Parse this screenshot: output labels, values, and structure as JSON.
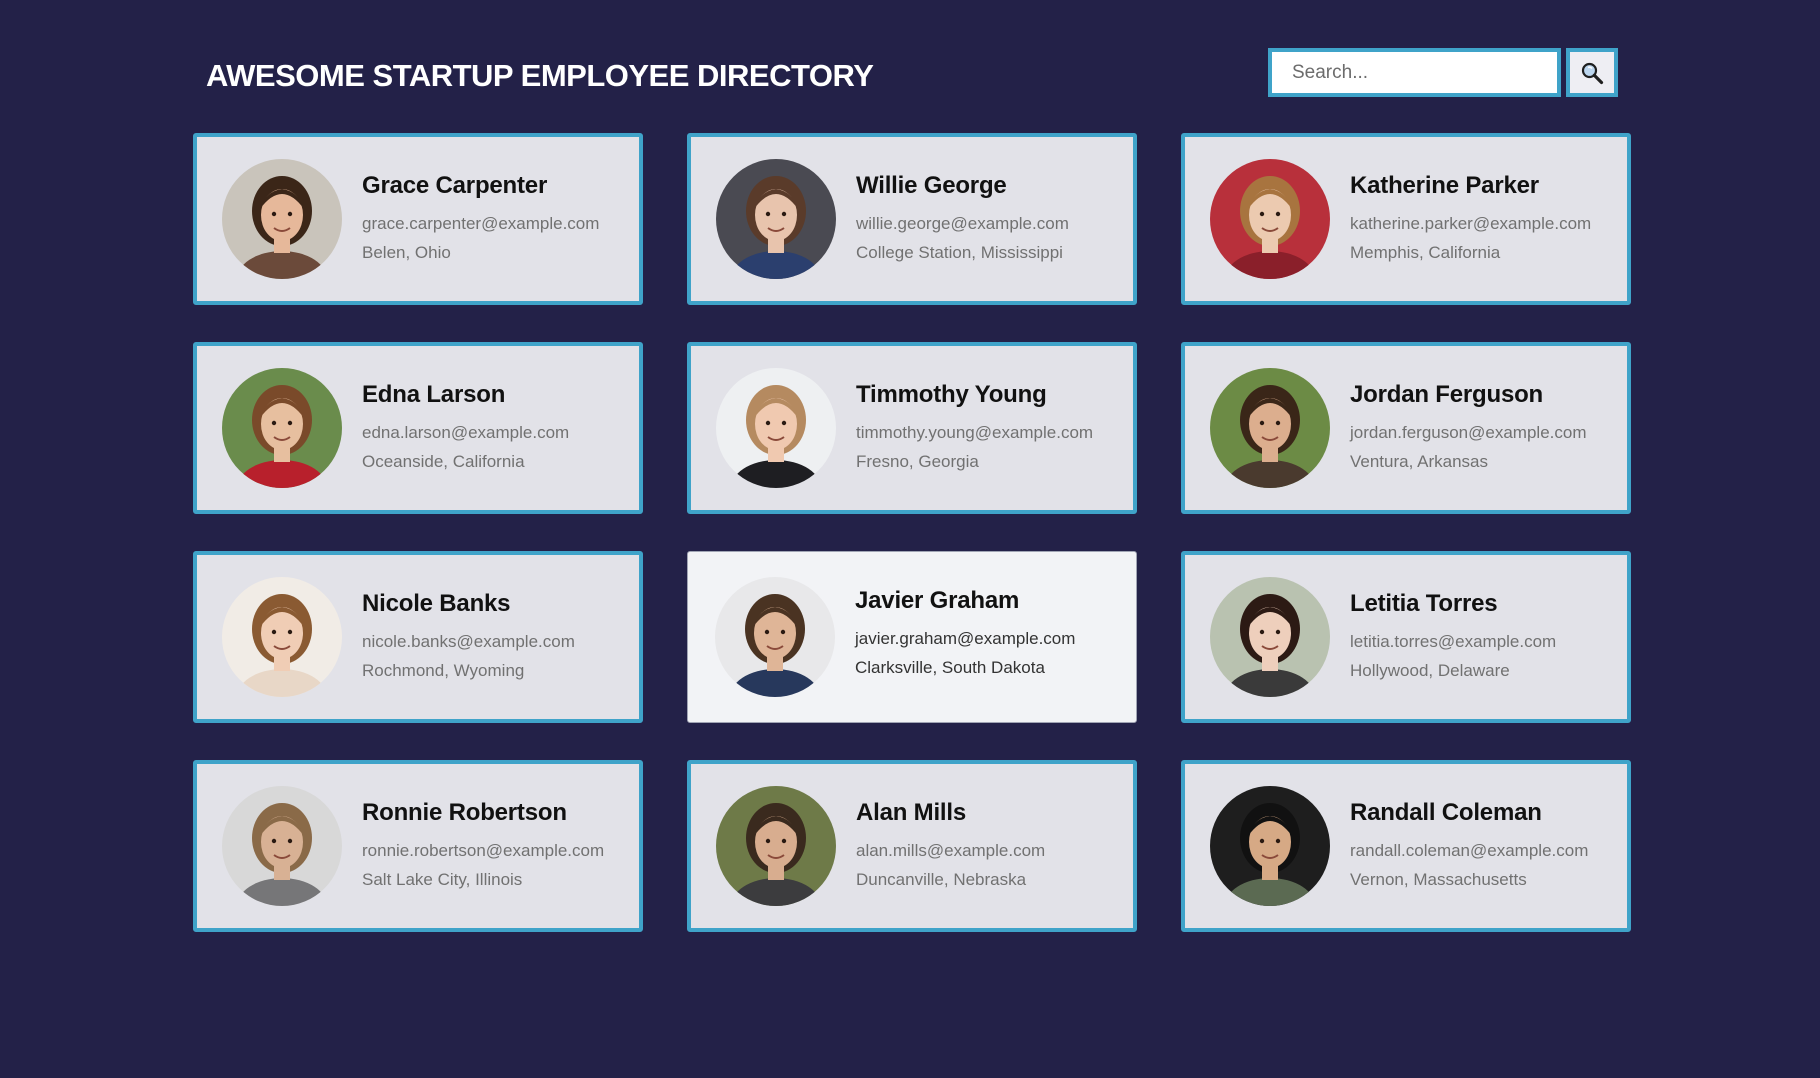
{
  "header": {
    "title": "AWESOME STARTUP EMPLOYEE DIRECTORY"
  },
  "search": {
    "placeholder": "Search...",
    "button_icon": "magnifier-icon"
  },
  "colors": {
    "background": "#232148",
    "accent": "#3fa3c9",
    "card": "#e2e2e8"
  },
  "employees": [
    {
      "name": "Grace Carpenter",
      "email": "grace.carpenter@example.com",
      "location": "Belen, Ohio",
      "skin": "#e6b89a",
      "hair": "#3b2618",
      "shirt": "#6b4a3a",
      "bg": "#c9c4bb"
    },
    {
      "name": "Willie George",
      "email": "willie.george@example.com",
      "location": "College Station, Mississippi",
      "skin": "#e8c4ad",
      "hair": "#5a3b2a",
      "shirt": "#2b3f6e",
      "bg": "#4a4a52"
    },
    {
      "name": "Katherine Parker",
      "email": "katherine.parker@example.com",
      "location": "Memphis, California",
      "skin": "#eccab0",
      "hair": "#a8743f",
      "shirt": "#8a1f2a",
      "bg": "#b8303b"
    },
    {
      "name": "Edna Larson",
      "email": "edna.larson@example.com",
      "location": "Oceanside, California",
      "skin": "#e7bf9f",
      "hair": "#7a4a2a",
      "shirt": "#b8202c",
      "bg": "#6a8c4c"
    },
    {
      "name": "Timmothy Young",
      "email": "timmothy.young@example.com",
      "location": "Fresno, Georgia",
      "skin": "#f0c9b0",
      "hair": "#b58a60",
      "shirt": "#1e1e22",
      "bg": "#eef0f2"
    },
    {
      "name": "Jordan Ferguson",
      "email": "jordan.ferguson@example.com",
      "location": "Ventura, Arkansas",
      "skin": "#dcae8e",
      "hair": "#3a2618",
      "shirt": "#4a3a2e",
      "bg": "#6c8b45"
    },
    {
      "name": "Nicole Banks",
      "email": "nicole.banks@example.com",
      "location": "Rochmond, Wyoming",
      "skin": "#f0cdb5",
      "hair": "#8a5a32",
      "shirt": "#e8d7c7",
      "bg": "#f1ece6"
    },
    {
      "name": "Javier Graham",
      "email": "javier.graham@example.com",
      "location": "Clarksville, South Dakota",
      "skin": "#dfb597",
      "hair": "#4a3322",
      "shirt": "#27385c",
      "bg": "#e8e8ea"
    },
    {
      "name": "Letitia Torres",
      "email": "letitia.torres@example.com",
      "location": "Hollywood, Delaware",
      "skin": "#eecfbc",
      "hair": "#2c1a14",
      "shirt": "#3a3a3a",
      "bg": "#b9c2b0"
    },
    {
      "name": "Ronnie Robertson",
      "email": "ronnie.robertson@example.com",
      "location": "Salt Lake City, Illinois",
      "skin": "#d8b194",
      "hair": "#8a6a48",
      "shirt": "#767678",
      "bg": "#d8d8d8"
    },
    {
      "name": "Alan Mills",
      "email": "alan.mills@example.com",
      "location": "Duncanville, Nebraska",
      "skin": "#d8ad8f",
      "hair": "#3a2a1e",
      "shirt": "#3c3c3e",
      "bg": "#6e7a48"
    },
    {
      "name": "Randall Coleman",
      "email": "randall.coleman@example.com",
      "location": "Vernon, Massachusetts",
      "skin": "#d6a985",
      "hair": "#111111",
      "shirt": "#5b6a52",
      "bg": "#1e1e1e"
    }
  ]
}
